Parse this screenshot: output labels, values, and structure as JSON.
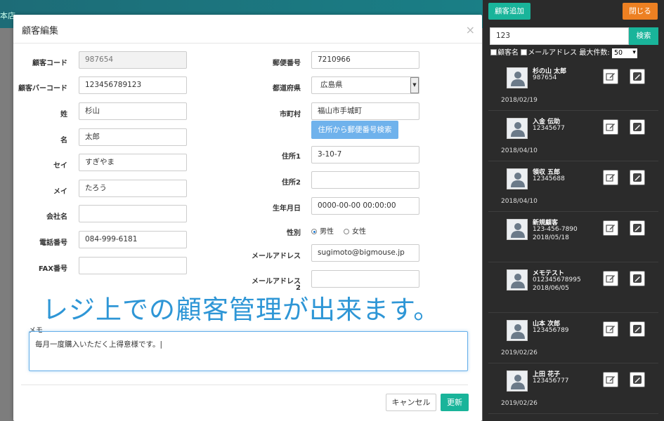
{
  "background": {
    "title": "本店"
  },
  "modal": {
    "title": "顧客編集",
    "close": "×",
    "labels": {
      "code": "顧客コード",
      "barcode": "顧客バーコード",
      "last": "姓",
      "first": "名",
      "last_kana": "セイ",
      "first_kana": "メイ",
      "company": "会社名",
      "phone": "電話番号",
      "fax": "FAX番号",
      "zip": "郵便番号",
      "pref": "都道府県",
      "city": "市町村",
      "addr1": "住所1",
      "addr2": "住所2",
      "birth": "生年月日",
      "gender": "性別",
      "email": "メールアドレス",
      "email2": "メールアドレス",
      "email2_suffix": "2",
      "memo": "メモ"
    },
    "values": {
      "code": "987654",
      "barcode": "123456789123",
      "last": "杉山",
      "first": "太郎",
      "last_kana": "すぎやま",
      "first_kana": "たろう",
      "company": "",
      "phone": "084-999-6181",
      "fax": "",
      "zip": "7210966",
      "pref": "広島県",
      "city": "福山市手城町",
      "addr1": "3-10-7",
      "addr2": "",
      "birth": "0000-00-00 00:00:00",
      "email": "sugimoto@bigmouse.jp",
      "email2": "",
      "memo": "毎月一度購入いただく上得意様です。|"
    },
    "gender_options": [
      "男性",
      "女性"
    ],
    "gender_selected": "男性",
    "zip_search_button": "住所から郵便番号検索",
    "overlay_caption": "レジ上での顧客管理が出来ます。",
    "cancel_button": "キャンセル",
    "update_button": "更新"
  },
  "panel": {
    "add_button": "顧客追加",
    "close_button": "閉じる",
    "search_value": "123",
    "search_button": "検索",
    "filter_name": "顧客名",
    "filter_email": "メールアドレス",
    "max_label": "最大件数:",
    "max_value": "50",
    "customers": [
      {
        "name": "杉の山 太郎",
        "code": "987654",
        "extra": "",
        "date": "2018/02/19"
      },
      {
        "name": "入金 伝助",
        "code": "12345677",
        "extra": "",
        "date": "2018/04/10"
      },
      {
        "name": "領収 五郎",
        "code": "12345688",
        "extra": "",
        "date": "2018/04/10"
      },
      {
        "name": "新規顧客",
        "code": "123-456-7890",
        "extra": "2018/05/18",
        "date": ""
      },
      {
        "name": "メモテスト",
        "code": "012345678995",
        "extra": "2018/06/05",
        "date": ""
      },
      {
        "name": "山本 次郎",
        "code": "123456789",
        "extra": "",
        "date": "2019/02/26"
      },
      {
        "name": "上田 花子",
        "code": "123456777",
        "extra": "",
        "date": "2019/02/26"
      }
    ]
  }
}
